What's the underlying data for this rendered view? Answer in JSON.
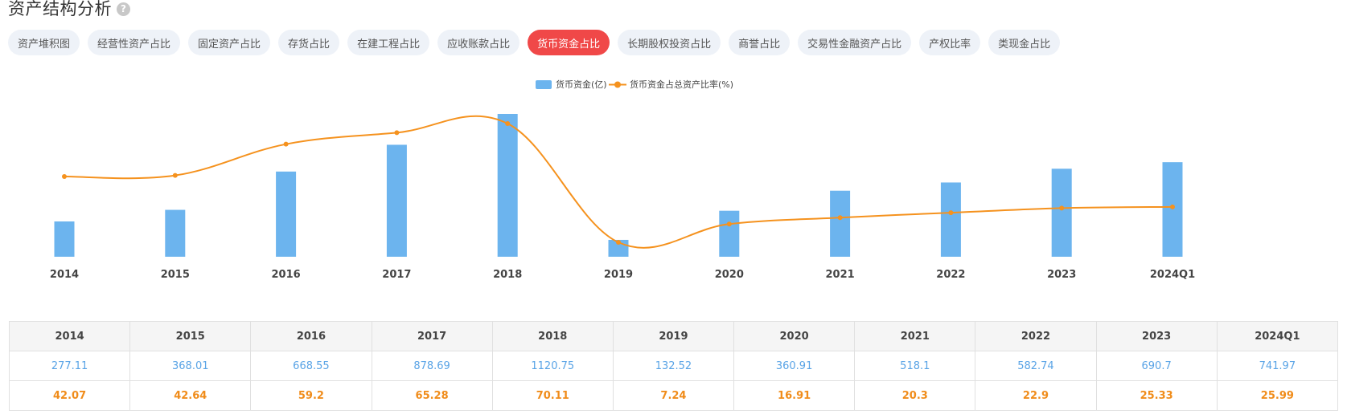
{
  "header": {
    "title": "资产结构分析",
    "help_icon": "question-circle-icon"
  },
  "tabs": [
    {
      "label": "资产堆积图",
      "active": false
    },
    {
      "label": "经营性资产占比",
      "active": false
    },
    {
      "label": "固定资产占比",
      "active": false
    },
    {
      "label": "存货占比",
      "active": false
    },
    {
      "label": "在建工程占比",
      "active": false
    },
    {
      "label": "应收账款占比",
      "active": false
    },
    {
      "label": "货币资金占比",
      "active": true
    },
    {
      "label": "长期股权投资占比",
      "active": false
    },
    {
      "label": "商誉占比",
      "active": false
    },
    {
      "label": "交易性金融资产占比",
      "active": false
    },
    {
      "label": "产权比率",
      "active": false
    },
    {
      "label": "类现金占比",
      "active": false
    }
  ],
  "colors": {
    "bar": "#6cb4ee",
    "line": "#f5921e",
    "active_tab": "#f04848"
  },
  "chart_data": {
    "type": "bar",
    "categories": [
      "2014",
      "2015",
      "2016",
      "2017",
      "2018",
      "2019",
      "2020",
      "2021",
      "2022",
      "2023",
      "2024Q1"
    ],
    "series": [
      {
        "name": "货币资金(亿)",
        "type": "bar",
        "values": [
          277.11,
          368.01,
          668.55,
          878.69,
          1120.75,
          132.52,
          360.91,
          518.1,
          582.74,
          690.7,
          741.97
        ]
      },
      {
        "name": "货币资金占总资产比率(%)",
        "type": "line",
        "values": [
          42.07,
          42.64,
          59.2,
          65.28,
          70.11,
          7.24,
          16.91,
          20.3,
          22.9,
          25.33,
          25.99
        ]
      }
    ],
    "legend": "top-center",
    "grid": false
  }
}
